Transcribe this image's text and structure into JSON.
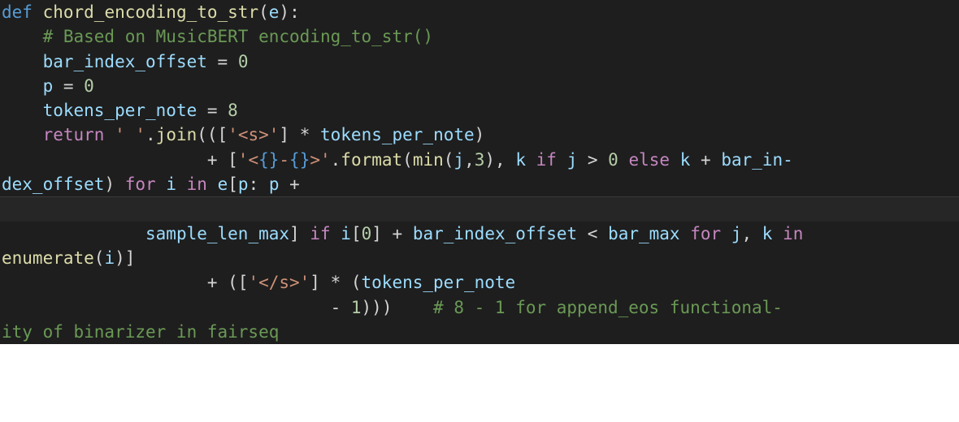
{
  "code_lines": [
    [
      {
        "t": "def",
        "c": "def"
      },
      {
        "t": " ",
        "c": "plain"
      },
      {
        "t": "chord_encoding_to_str",
        "c": "function"
      },
      {
        "t": "(",
        "c": "plain"
      },
      {
        "t": "e",
        "c": "param"
      },
      {
        "t": "):",
        "c": "plain"
      }
    ],
    [
      {
        "t": "    ",
        "c": "plain"
      },
      {
        "t": "# Based on MusicBERT encoding_to_str()",
        "c": "comment"
      }
    ],
    [
      {
        "t": "    ",
        "c": "plain"
      },
      {
        "t": "bar_index_offset",
        "c": "var"
      },
      {
        "t": " = ",
        "c": "plain"
      },
      {
        "t": "0",
        "c": "number"
      }
    ],
    [
      {
        "t": "    ",
        "c": "plain"
      },
      {
        "t": "p",
        "c": "var"
      },
      {
        "t": " = ",
        "c": "plain"
      },
      {
        "t": "0",
        "c": "number"
      }
    ],
    [
      {
        "t": "    ",
        "c": "plain"
      },
      {
        "t": "tokens_per_note",
        "c": "var"
      },
      {
        "t": " = ",
        "c": "plain"
      },
      {
        "t": "8",
        "c": "number"
      }
    ],
    [
      {
        "t": "    ",
        "c": "plain"
      },
      {
        "t": "return",
        "c": "keyword"
      },
      {
        "t": " ",
        "c": "plain"
      },
      {
        "t": "' '",
        "c": "string"
      },
      {
        "t": ".",
        "c": "plain"
      },
      {
        "t": "join",
        "c": "function"
      },
      {
        "t": "(([",
        "c": "plain"
      },
      {
        "t": "'<s>'",
        "c": "string"
      },
      {
        "t": "] * ",
        "c": "plain"
      },
      {
        "t": "tokens_per_note",
        "c": "var"
      },
      {
        "t": ")",
        "c": "plain"
      }
    ],
    [
      {
        "t": "                    + [",
        "c": "plain"
      },
      {
        "t": "'<",
        "c": "string"
      },
      {
        "t": "{}",
        "c": "fmt"
      },
      {
        "t": "-",
        "c": "string"
      },
      {
        "t": "{}",
        "c": "fmt"
      },
      {
        "t": ">'",
        "c": "string"
      },
      {
        "t": ".",
        "c": "plain"
      },
      {
        "t": "format",
        "c": "function"
      },
      {
        "t": "(",
        "c": "plain"
      },
      {
        "t": "min",
        "c": "function"
      },
      {
        "t": "(",
        "c": "plain"
      },
      {
        "t": "j",
        "c": "var"
      },
      {
        "t": ",",
        "c": "plain"
      },
      {
        "t": "3",
        "c": "number"
      },
      {
        "t": "), ",
        "c": "plain"
      },
      {
        "t": "k",
        "c": "var"
      },
      {
        "t": " ",
        "c": "plain"
      },
      {
        "t": "if",
        "c": "keyword"
      },
      {
        "t": " ",
        "c": "plain"
      },
      {
        "t": "j",
        "c": "var"
      },
      {
        "t": " > ",
        "c": "plain"
      },
      {
        "t": "0",
        "c": "number"
      },
      {
        "t": " ",
        "c": "plain"
      },
      {
        "t": "else",
        "c": "keyword"
      },
      {
        "t": " ",
        "c": "plain"
      },
      {
        "t": "k",
        "c": "var"
      },
      {
        "t": " + ",
        "c": "plain"
      },
      {
        "t": "bar_in-",
        "c": "var"
      }
    ],
    [
      {
        "t": "dex_offset",
        "c": "var"
      },
      {
        "t": ") ",
        "c": "plain"
      },
      {
        "t": "for",
        "c": "keyword"
      },
      {
        "t": " ",
        "c": "plain"
      },
      {
        "t": "i",
        "c": "var"
      },
      {
        "t": " ",
        "c": "plain"
      },
      {
        "t": "in",
        "c": "keyword"
      },
      {
        "t": " ",
        "c": "plain"
      },
      {
        "t": "e",
        "c": "var"
      },
      {
        "t": "[",
        "c": "plain"
      },
      {
        "t": "p",
        "c": "var"
      },
      {
        "t": ": ",
        "c": "plain"
      },
      {
        "t": "p",
        "c": "var"
      },
      {
        "t": " +",
        "c": "plain"
      }
    ],
    [],
    [
      {
        "t": "              ",
        "c": "plain"
      },
      {
        "t": "sample_len_max",
        "c": "var"
      },
      {
        "t": "] ",
        "c": "plain"
      },
      {
        "t": "if",
        "c": "keyword"
      },
      {
        "t": " ",
        "c": "plain"
      },
      {
        "t": "i",
        "c": "var"
      },
      {
        "t": "[",
        "c": "plain"
      },
      {
        "t": "0",
        "c": "number"
      },
      {
        "t": "] + ",
        "c": "plain"
      },
      {
        "t": "bar_index_offset",
        "c": "var"
      },
      {
        "t": " < ",
        "c": "plain"
      },
      {
        "t": "bar_max",
        "c": "var"
      },
      {
        "t": " ",
        "c": "plain"
      },
      {
        "t": "for",
        "c": "keyword"
      },
      {
        "t": " ",
        "c": "plain"
      },
      {
        "t": "j",
        "c": "var"
      },
      {
        "t": ", ",
        "c": "plain"
      },
      {
        "t": "k",
        "c": "var"
      },
      {
        "t": " ",
        "c": "plain"
      },
      {
        "t": "in",
        "c": "keyword"
      }
    ],
    [
      {
        "t": "enumerate",
        "c": "function"
      },
      {
        "t": "(",
        "c": "plain"
      },
      {
        "t": "i",
        "c": "var"
      },
      {
        "t": ")]",
        "c": "plain"
      }
    ],
    [
      {
        "t": "                    + ([",
        "c": "plain"
      },
      {
        "t": "'</s>'",
        "c": "string"
      },
      {
        "t": "] * (",
        "c": "plain"
      },
      {
        "t": "tokens_per_note",
        "c": "var"
      }
    ],
    [
      {
        "t": "                                - ",
        "c": "plain"
      },
      {
        "t": "1",
        "c": "number"
      },
      {
        "t": ")))    ",
        "c": "plain"
      },
      {
        "t": "# 8 - 1 for append_eos functional-",
        "c": "comment"
      }
    ],
    [
      {
        "t": "ity of binarizer in fairseq",
        "c": "comment"
      }
    ]
  ],
  "line_backgrounds": [
    "dark",
    "dark",
    "dark",
    "dark",
    "dark",
    "dark",
    "dark",
    "dark",
    "light",
    "dark",
    "dark",
    "dark",
    "dark",
    "dark"
  ]
}
